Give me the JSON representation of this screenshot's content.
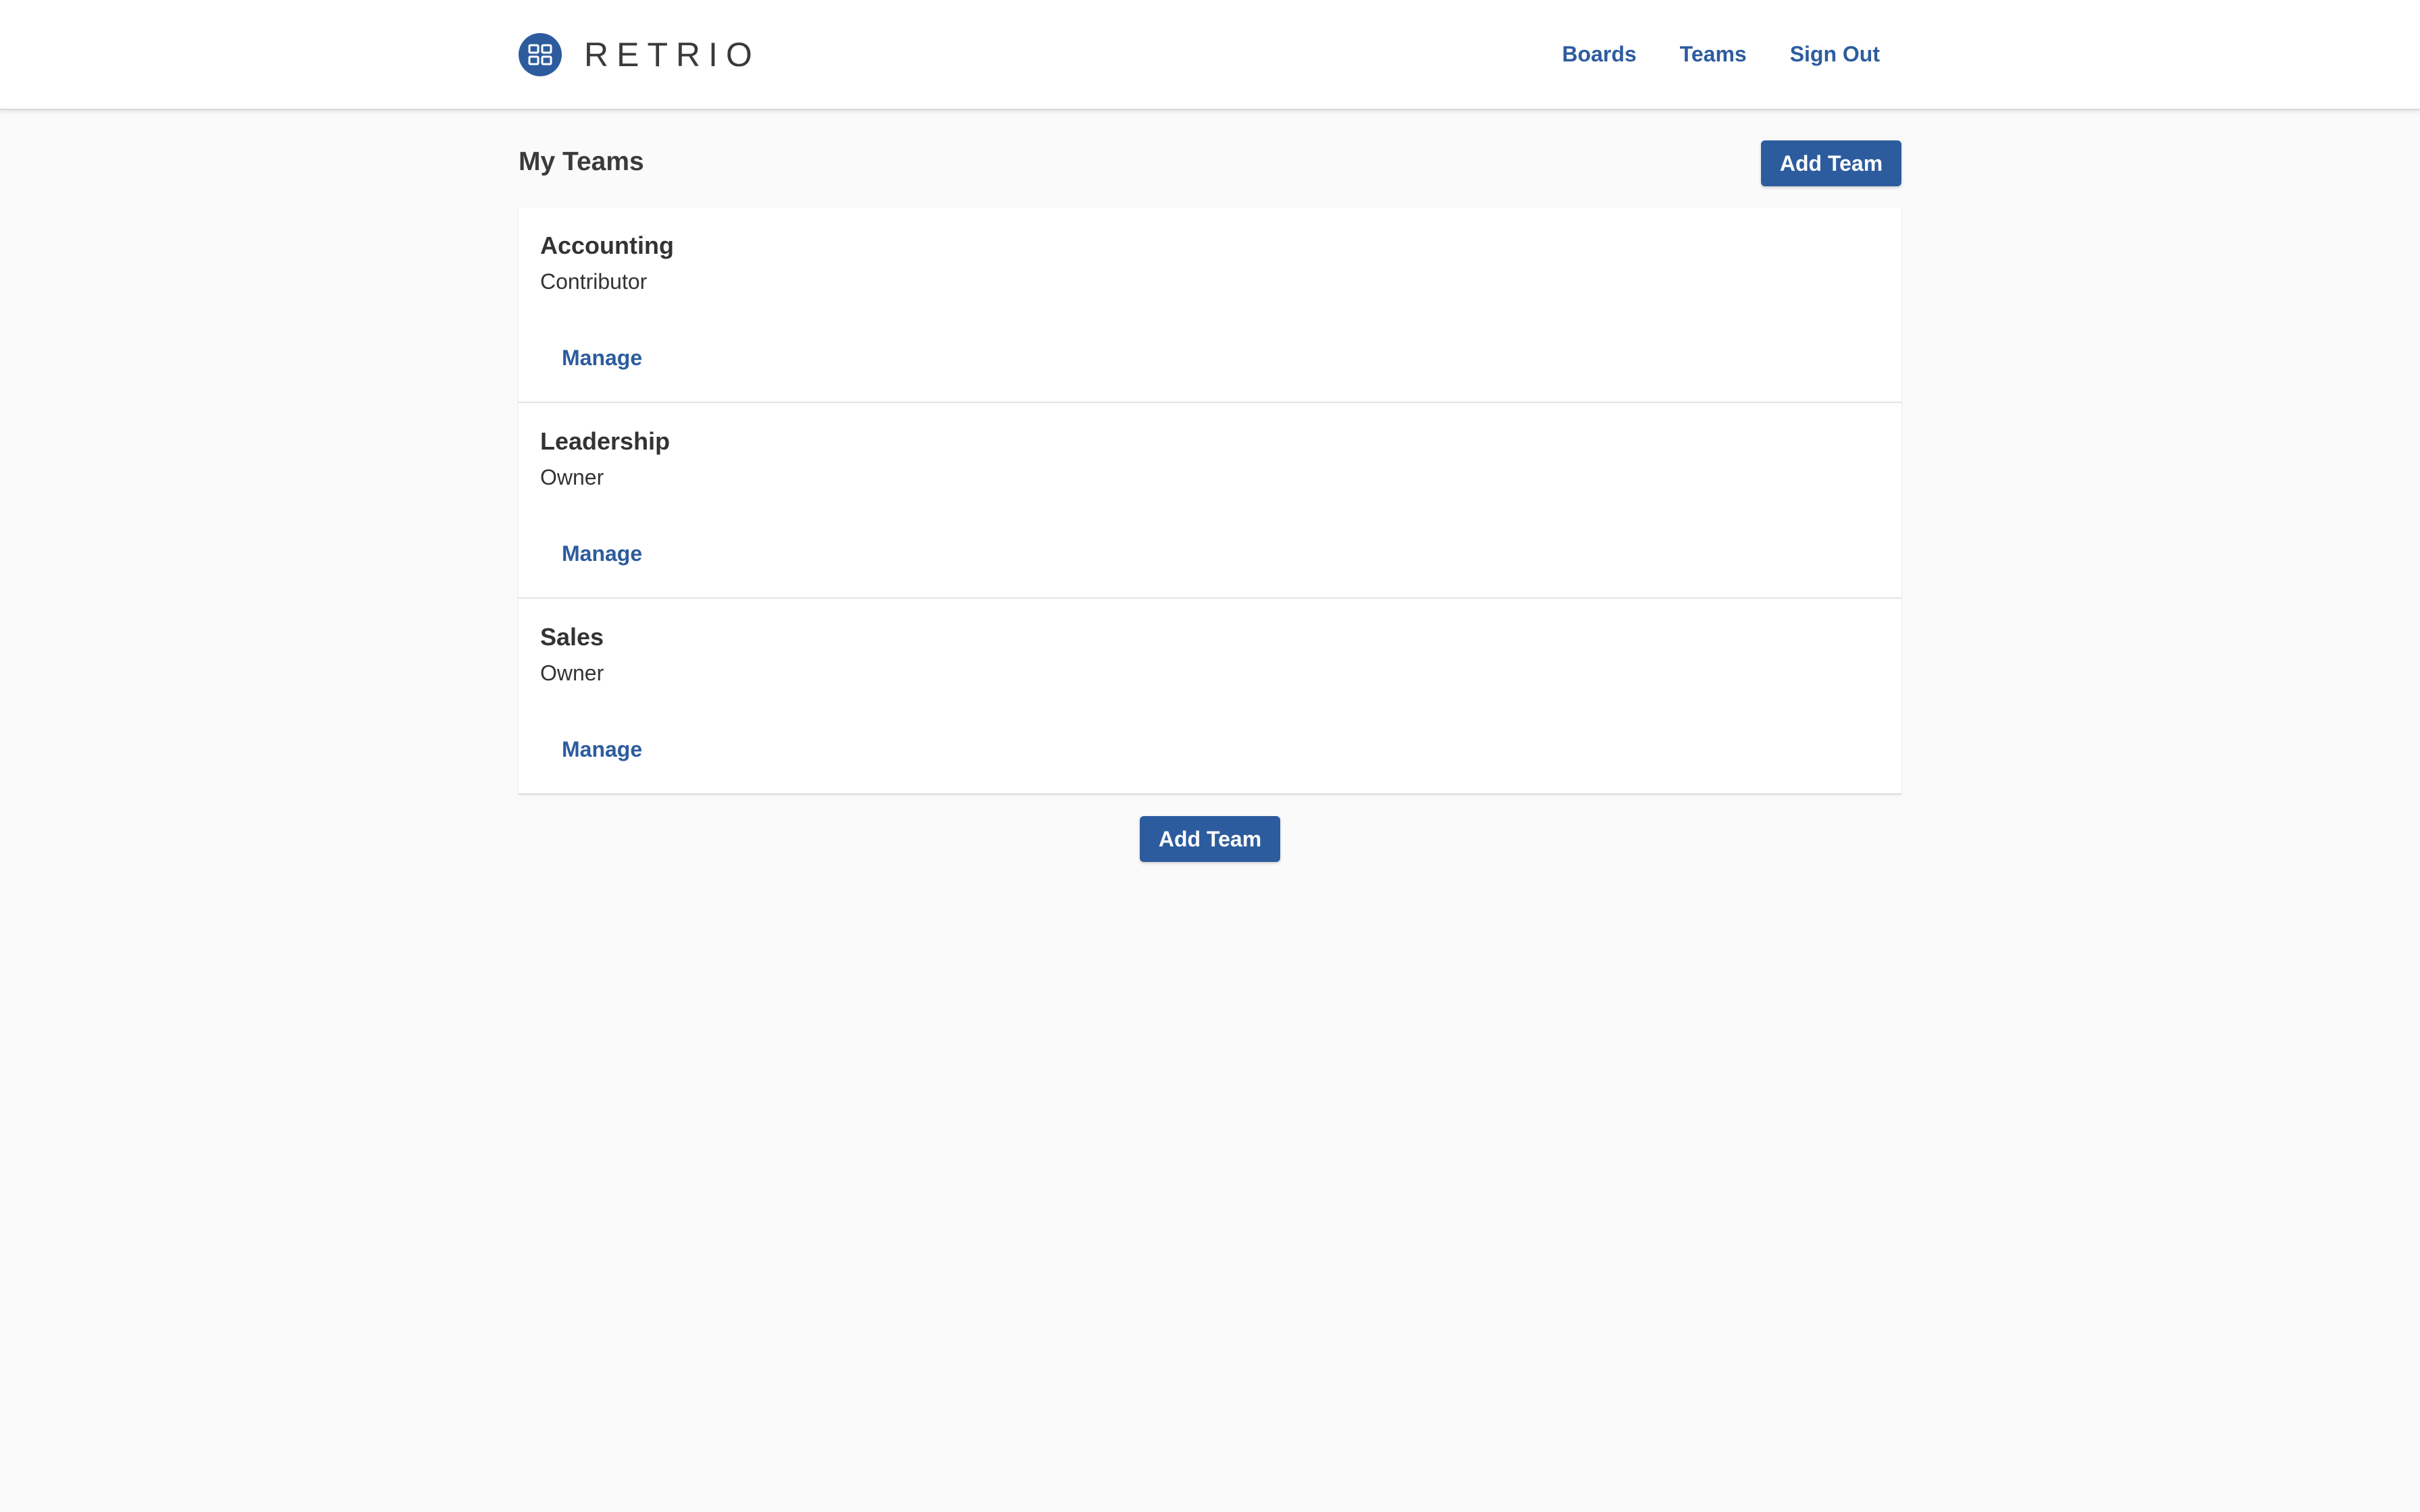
{
  "header": {
    "brand_name": "RETRIO",
    "logo_icon": "grid-icon",
    "nav": [
      {
        "label": "Boards"
      },
      {
        "label": "Teams"
      },
      {
        "label": "Sign Out"
      }
    ]
  },
  "main": {
    "title": "My Teams",
    "add_team_top_label": "Add Team",
    "add_team_bottom_label": "Add Team",
    "teams": [
      {
        "name": "Accounting",
        "role": "Contributor",
        "manage_label": "Manage"
      },
      {
        "name": "Leadership",
        "role": "Owner",
        "manage_label": "Manage"
      },
      {
        "name": "Sales",
        "role": "Owner",
        "manage_label": "Manage"
      }
    ]
  },
  "colors": {
    "primary": "#2d5c9e",
    "background": "#fafafa",
    "card": "#ffffff",
    "text": "#333333"
  }
}
